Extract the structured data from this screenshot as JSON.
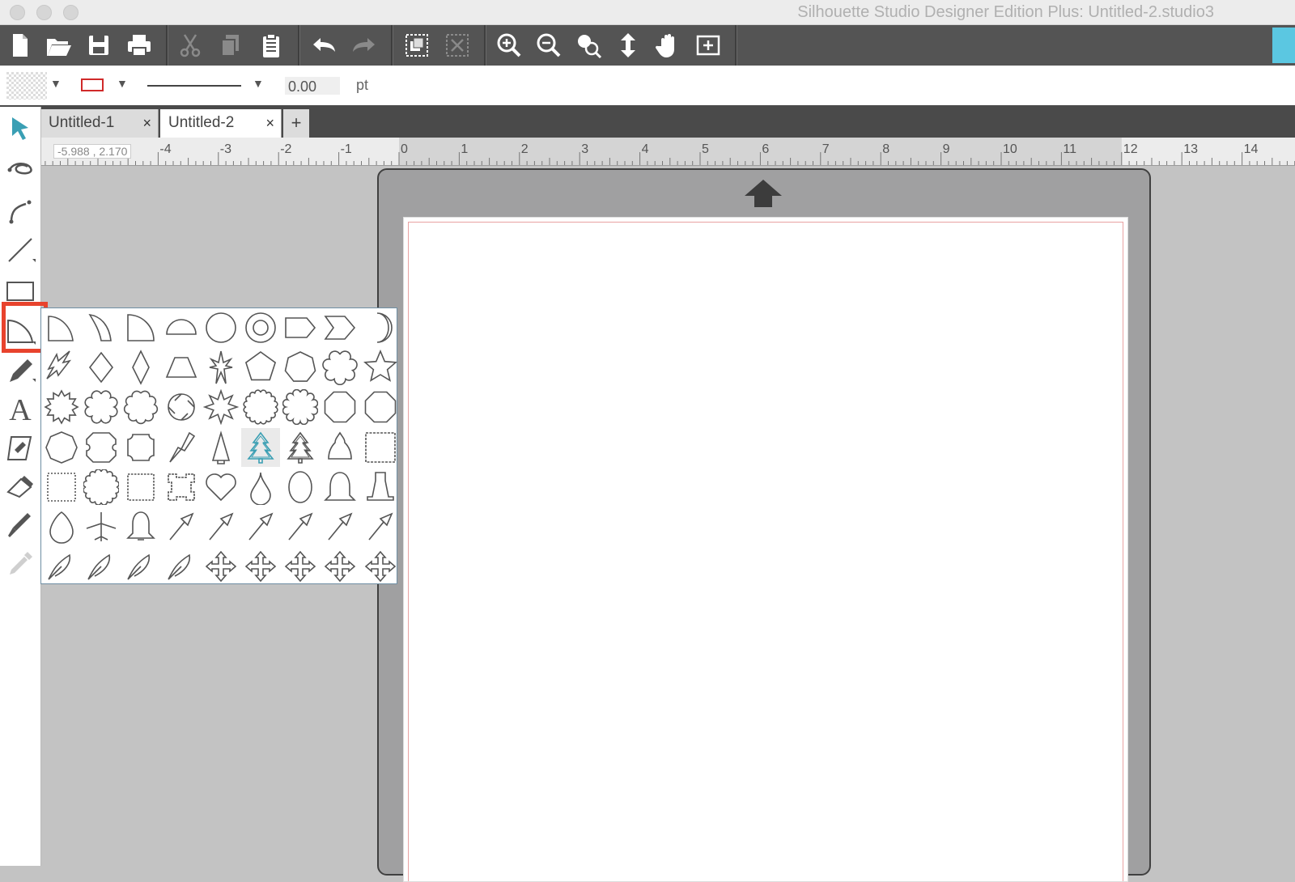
{
  "window": {
    "title": "Silhouette Studio Designer Edition Plus: Untitled-2.studio3"
  },
  "toolbar": {
    "buttons": [
      "new-document-icon",
      "open-folder-icon",
      "save-icon",
      "print-icon",
      "cut-icon",
      "copy-icon",
      "paste-icon",
      "undo-icon",
      "redo-icon",
      "group-icon",
      "ungroup-icon",
      "zoom-in-icon",
      "zoom-out-icon",
      "zoom-selection-icon",
      "move-down-icon",
      "pan-hand-icon",
      "fit-to-page-icon"
    ]
  },
  "options": {
    "line_width_value": "0.00",
    "line_width_unit": "pt"
  },
  "tabs": [
    {
      "label": "Untitled-1",
      "close": "×"
    },
    {
      "label": "Untitled-2",
      "close": "×"
    }
  ],
  "tab_add": "+",
  "ruler": {
    "coordinates": "-5.988 , 2.170",
    "labels": [
      "-4",
      "-3",
      "-2",
      "-1",
      "0",
      "1",
      "2",
      "3",
      "4",
      "5",
      "6",
      "7",
      "8",
      "9",
      "10",
      "11",
      "12",
      "13",
      "14"
    ]
  },
  "colors": {
    "accent": "#5bc7e1",
    "highlight": "#e8432d",
    "toolbar": "#545454",
    "mat": "#a0a0a1",
    "cut_line": "#e9a2a2"
  },
  "shapes_panel": {
    "selected": "tree-2"
  }
}
